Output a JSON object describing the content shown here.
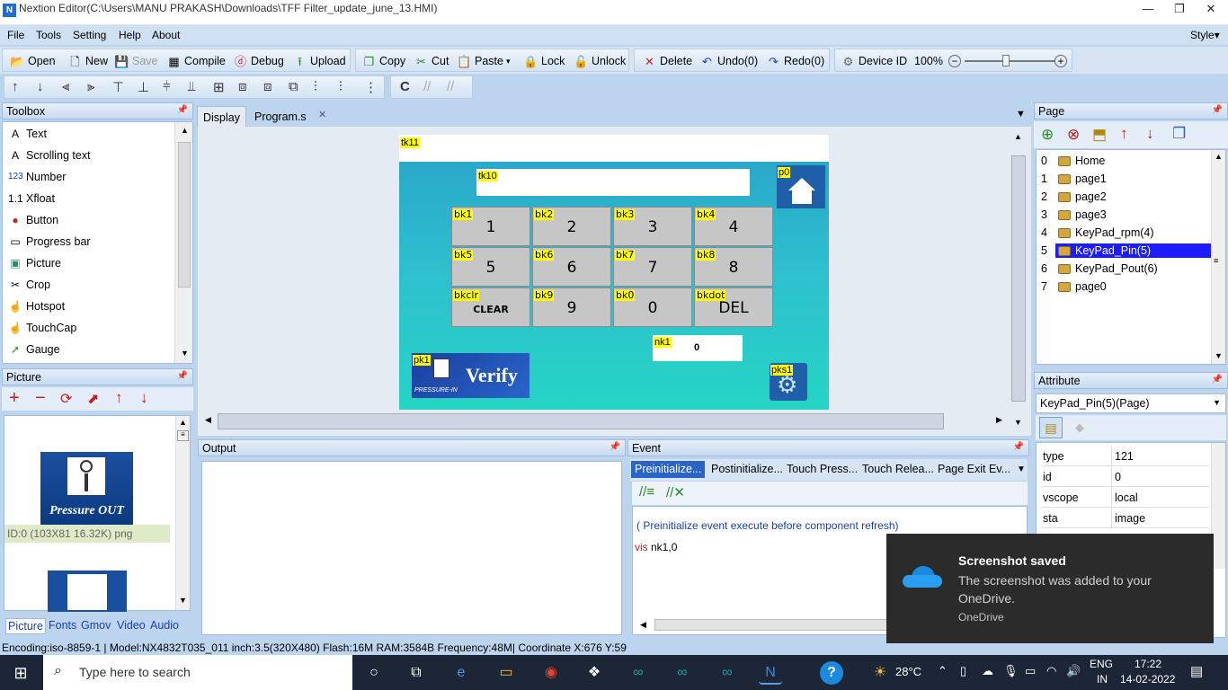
{
  "window": {
    "title": "Nextion Editor(C:\\Users\\MANU PRAKASH\\Downloads\\TFF Filter_update_june_13.HMI)",
    "icon_label": "N"
  },
  "menu": {
    "items": [
      "File",
      "Tools",
      "Setting",
      "Help",
      "About"
    ],
    "style": "Style"
  },
  "toolbar": {
    "open": "Open",
    "new": "New",
    "save": "Save",
    "compile": "Compile",
    "debug": "Debug",
    "upload": "Upload",
    "copy": "Copy",
    "cut": "Cut",
    "paste": "Paste",
    "lock": "Lock",
    "unlock": "Unlock",
    "delete": "Delete",
    "undo": "Undo(0)",
    "redo": "Redo(0)",
    "device_id": "Device ID",
    "zoom": "100%"
  },
  "toolbox": {
    "title": "Toolbox",
    "items": [
      {
        "icon": "text-icon",
        "glyph": "A",
        "label": "Text"
      },
      {
        "icon": "scrolling-text-icon",
        "glyph": "A",
        "label": "Scrolling text"
      },
      {
        "icon": "number-icon",
        "glyph": "123",
        "label": "Number"
      },
      {
        "icon": "xfloat-icon",
        "glyph": "1.1",
        "label": "Xfloat"
      },
      {
        "icon": "button-icon",
        "glyph": "●",
        "label": "Button"
      },
      {
        "icon": "progress-bar-icon",
        "glyph": "▭",
        "label": "Progress bar"
      },
      {
        "icon": "picture-icon",
        "glyph": "▣",
        "label": "Picture"
      },
      {
        "icon": "crop-icon",
        "glyph": "✂",
        "label": "Crop"
      },
      {
        "icon": "hotspot-icon",
        "glyph": "☝",
        "label": "Hotspot"
      },
      {
        "icon": "touchcap-icon",
        "glyph": "☝",
        "label": "TouchCap"
      },
      {
        "icon": "gauge-icon",
        "glyph": "➚",
        "label": "Gauge"
      }
    ]
  },
  "picture_panel": {
    "title": "Picture",
    "thumb_caption": "Pressure OUT",
    "selected_info": "ID:0  (103X81 16.32K) png",
    "bottom_tabs": [
      "Picture",
      "Fonts",
      "Gmov",
      "Video",
      "Audio"
    ]
  },
  "doc_tabs": [
    "Display",
    "Program.s"
  ],
  "device": {
    "tk11": "tk11",
    "tk10": "tk10",
    "p0": "p0",
    "keys": [
      {
        "id": "bk1",
        "text": "1"
      },
      {
        "id": "bk2",
        "text": "2"
      },
      {
        "id": "bk3",
        "text": "3"
      },
      {
        "id": "bk4",
        "text": "4"
      },
      {
        "id": "bk5",
        "text": "5"
      },
      {
        "id": "bk6",
        "text": "6"
      },
      {
        "id": "bk7",
        "text": "7"
      },
      {
        "id": "bk8",
        "text": "8"
      },
      {
        "id": "bkclr",
        "text": "CLEAR"
      },
      {
        "id": "bk9",
        "text": "9"
      },
      {
        "id": "bk0",
        "text": "0"
      },
      {
        "id": "bkdot",
        "text": "DEL"
      }
    ],
    "nk1_label": "nk1",
    "nk1_value": "0",
    "pk1_label": "pk1",
    "verify_text": "Verify",
    "verify_small": "PRESSURE-IN",
    "pks1_label": "pks1"
  },
  "output": {
    "title": "Output"
  },
  "event": {
    "title": "Event",
    "tabs": [
      "Preinitialize...",
      "Postinitialize...",
      "Touch Press...",
      "Touch Relea...",
      "Page Exit Ev..."
    ],
    "comment": "( Preinitialize event execute before component refresh)",
    "code_keyword": "vis",
    "code_rest": " nk1,0"
  },
  "page_panel": {
    "title": "Page",
    "pages": [
      {
        "index": "0",
        "name": "Home"
      },
      {
        "index": "1",
        "name": "page1"
      },
      {
        "index": "2",
        "name": "page2"
      },
      {
        "index": "3",
        "name": "page3"
      },
      {
        "index": "4",
        "name": "KeyPad_rpm(4)"
      },
      {
        "index": "5",
        "name": "KeyPad_Pin(5)"
      },
      {
        "index": "6",
        "name": "KeyPad_Pout(6)"
      },
      {
        "index": "7",
        "name": "page0"
      }
    ],
    "selected_index": 5
  },
  "attribute": {
    "title": "Attribute",
    "selector": "KeyPad_Pin(5)(Page)",
    "rows": [
      {
        "name": "type",
        "value": "121"
      },
      {
        "name": "id",
        "value": "0"
      },
      {
        "name": "vscope",
        "value": "local"
      },
      {
        "name": "sta",
        "value": "image"
      }
    ]
  },
  "status": {
    "text": "Encoding:iso-8859-1 | Model:NX4832T035_011  inch:3.5(320X480) Flash:16M RAM:3584B Frequency:48M|   Coordinate X:676  Y:59"
  },
  "toast": {
    "title": "Screenshot saved",
    "body": "The screenshot was added to your OneDrive.",
    "source": "OneDrive"
  },
  "taskbar": {
    "search": "Type here to search",
    "weather": "28°C",
    "lang_top": "ENG",
    "lang_bottom": "IN",
    "time": "17:22",
    "date": "14-02-2022"
  },
  "colors": {
    "accent": "#1a3fb0",
    "selected_page": "#1c1cff",
    "toolbar_bg": "#d6e4f4",
    "device_bg": "#2ec0cf",
    "toast_bg": "#2b2b2b"
  }
}
